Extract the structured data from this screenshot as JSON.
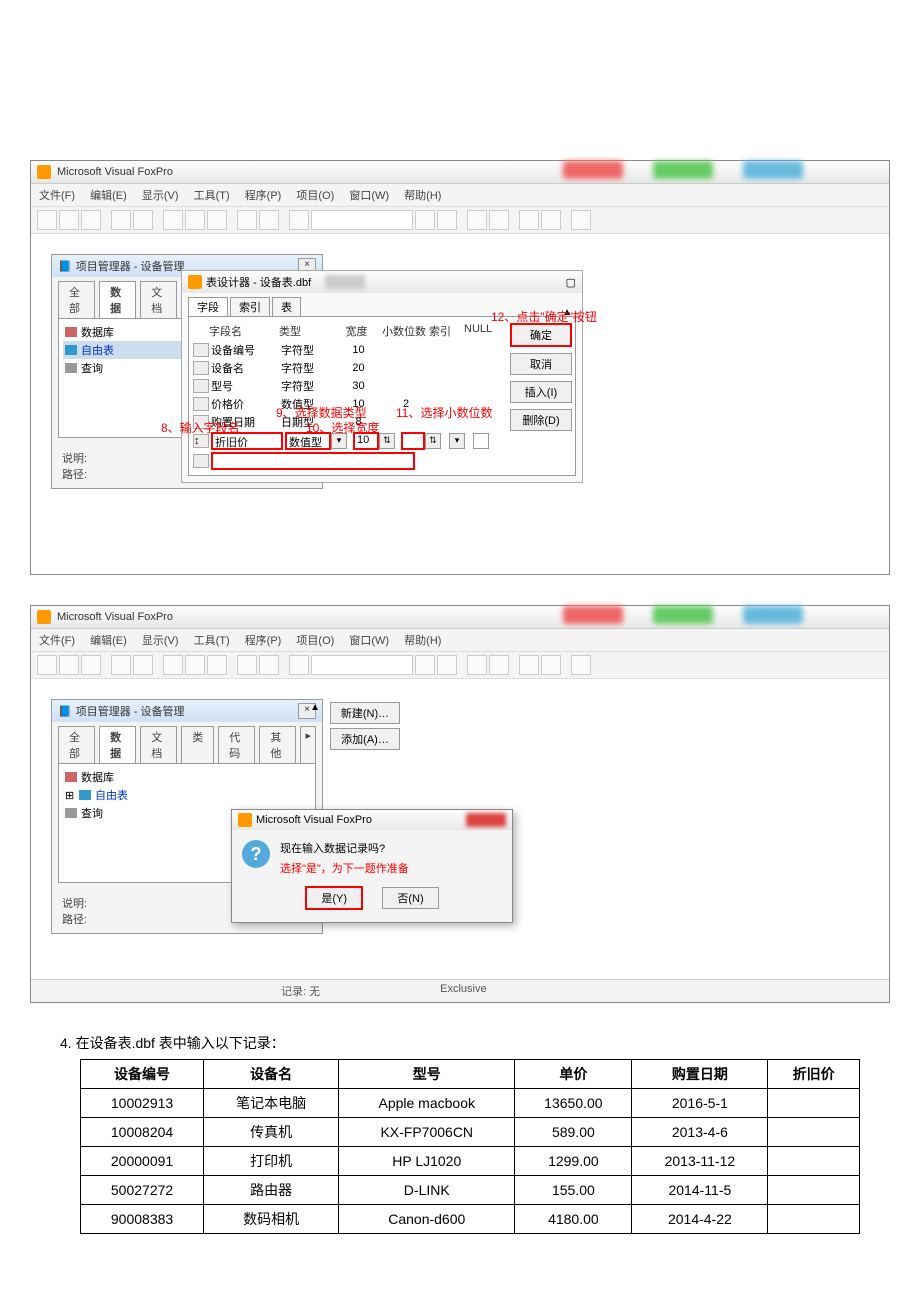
{
  "app_title": "Microsoft Visual FoxPro",
  "menu": [
    "文件(F)",
    "编辑(E)",
    "显示(V)",
    "工具(T)",
    "程序(P)",
    "项目(O)",
    "窗口(W)",
    "帮助(H)"
  ],
  "pm": {
    "title": "项目管理器 - 设备管理",
    "tabs": [
      "全部",
      "数据",
      "文档",
      "类",
      "代码",
      "其他"
    ],
    "active_tab": "数据",
    "items": [
      "数据库",
      "自由表",
      "查询"
    ],
    "desc_label": "说明:",
    "path_label": "路径:",
    "new_btn": "新建(N)…",
    "add_btn": "添加(A)…"
  },
  "td": {
    "title": "表设计器 - 设备表.dbf",
    "tabs": [
      "字段",
      "索引",
      "表"
    ],
    "headers": [
      "字段名",
      "类型",
      "宽度",
      "小数位数",
      "索引",
      "NULL"
    ],
    "rows": [
      {
        "name": "设备编号",
        "type": "字符型",
        "width": "10",
        "dec": ""
      },
      {
        "name": "设备名",
        "type": "字符型",
        "width": "20",
        "dec": ""
      },
      {
        "name": "型号",
        "type": "字符型",
        "width": "30",
        "dec": ""
      },
      {
        "name": "价格价",
        "type": "数值型",
        "width": "10",
        "dec": "2"
      },
      {
        "name": "购置日期",
        "type": "日期型",
        "width": "8",
        "dec": ""
      }
    ],
    "edit_row": {
      "name": "折旧价",
      "type": "数值型",
      "width": "10",
      "dec": ""
    },
    "buttons": {
      "ok": "确定",
      "cancel": "取消",
      "insert": "插入(I)",
      "delete": "删除(D)"
    }
  },
  "ann": {
    "a12": "12、点击\"确定\"按钮",
    "a9": "9、选择数据类型",
    "a11": "11、选择小数位数",
    "a8": "8、输入字段名",
    "a10": "10、选择宽度"
  },
  "dlg": {
    "title": "Microsoft Visual FoxPro",
    "msg": "现在输入数据记录吗?",
    "note": "选择\"是\"，为下一题作准备",
    "yes": "是(Y)",
    "no": "否(N)"
  },
  "status": {
    "rec": "记录: 无",
    "mode": "Exclusive"
  },
  "sec4_title": "4. 在设备表.dbf 表中输入以下记录：",
  "tbl": {
    "headers": [
      "设备编号",
      "设备名",
      "型号",
      "单价",
      "购置日期",
      "折旧价"
    ],
    "rows": [
      [
        "10002913",
        "笔记本电脑",
        "Apple macbook",
        "13650.00",
        "2016-5-1",
        ""
      ],
      [
        "10008204",
        "传真机",
        "KX-FP7006CN",
        "589.00",
        "2013-4-6",
        ""
      ],
      [
        "20000091",
        "打印机",
        "HP LJ1020",
        "1299.00",
        "2013-11-12",
        ""
      ],
      [
        "50027272",
        "路由器",
        "D-LINK",
        "155.00",
        "2014-11-5",
        ""
      ],
      [
        "90008383",
        "数码相机",
        "Canon-d600",
        "4180.00",
        "2014-4-22",
        ""
      ]
    ]
  }
}
